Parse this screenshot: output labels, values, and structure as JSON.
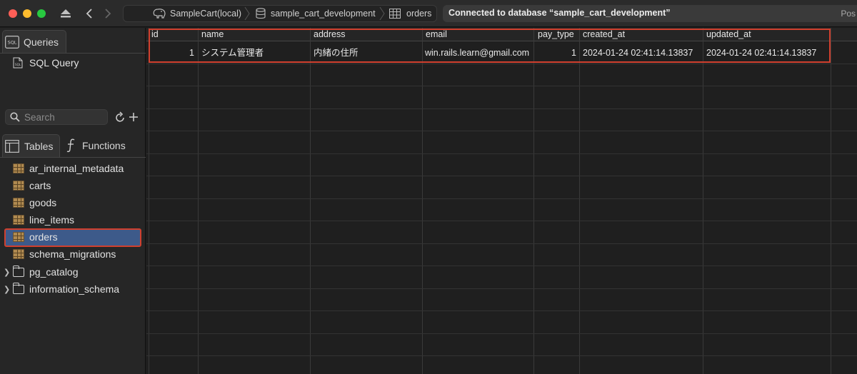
{
  "toolbar": {
    "breadcrumbs": [
      {
        "label": "SampleCart(local)",
        "icon": "elephant-icon"
      },
      {
        "label": "sample_cart_development",
        "icon": "database-icon"
      },
      {
        "label": "orders",
        "icon": "table-icon"
      }
    ],
    "status": "Connected to database “sample_cart_development”",
    "status_suffix": "Pos"
  },
  "sidebar": {
    "queries_tab": "Queries",
    "sql_query_item": "SQL Query",
    "search_placeholder": "Search",
    "tables_tab": "Tables",
    "functions_tab": "Functions",
    "tables": [
      {
        "label": "ar_internal_metadata"
      },
      {
        "label": "carts"
      },
      {
        "label": "goods"
      },
      {
        "label": "line_items"
      },
      {
        "label": "orders"
      },
      {
        "label": "schema_migrations"
      }
    ],
    "schemas": [
      {
        "label": "pg_catalog"
      },
      {
        "label": "information_schema"
      }
    ],
    "selected_table": "orders"
  },
  "grid": {
    "columns": [
      "id",
      "name",
      "address",
      "email",
      "pay_type",
      "created_at",
      "updated_at"
    ],
    "rows": [
      {
        "id": "1",
        "name": "システム管理者",
        "address": "内緒の住所",
        "email": "win.rails.learn@gmail.com",
        "pay_type": "1",
        "created_at": "2024-01-24 02:41:14.13837",
        "updated_at": "2024-01-24 02:41:14.13837"
      }
    ]
  },
  "colors": {
    "highlight_border": "#d0402e",
    "selection": "#3d5a8a"
  }
}
